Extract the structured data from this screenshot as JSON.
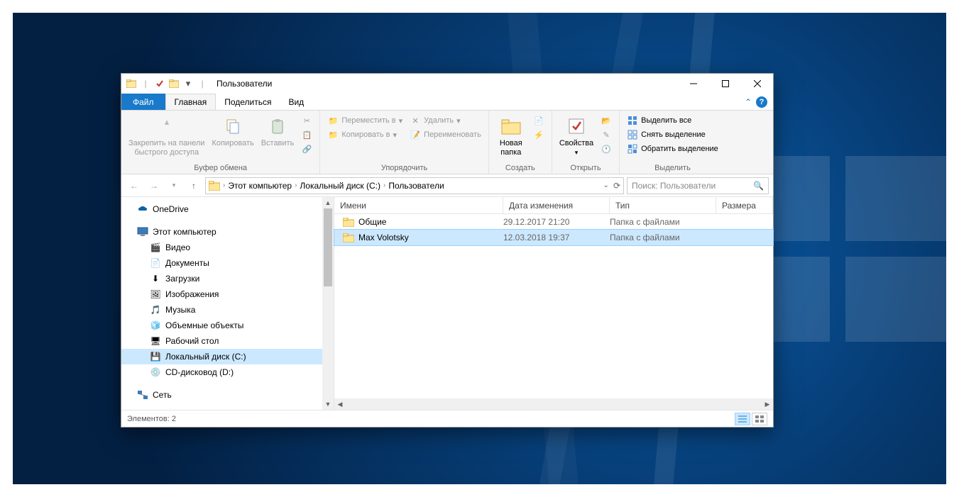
{
  "window": {
    "title": "Пользователи",
    "tabs": {
      "file": "Файл",
      "home": "Главная",
      "share": "Поделиться",
      "view": "Вид"
    }
  },
  "ribbon": {
    "clipboard": {
      "label": "Буфер обмена",
      "pin": "Закрепить на панели\nбыстрого доступа",
      "copy": "Копировать",
      "paste": "Вставить"
    },
    "organize": {
      "label": "Упорядочить",
      "move": "Переместить в",
      "copyto": "Копировать в",
      "delete": "Удалить",
      "rename": "Переименовать"
    },
    "new": {
      "label": "Создать",
      "folder": "Новая\nпапка"
    },
    "open": {
      "label": "Открыть",
      "props": "Свойства"
    },
    "select": {
      "label": "Выделить",
      "all": "Выделить все",
      "none": "Снять выделение",
      "invert": "Обратить выделение"
    }
  },
  "breadcrumbs": [
    "Этот компьютер",
    "Локальный диск (C:)",
    "Пользователи"
  ],
  "search": {
    "placeholder": "Поиск: Пользователи"
  },
  "tree": {
    "onedrive": "OneDrive",
    "thispc": "Этот компьютер",
    "items": [
      "Видео",
      "Документы",
      "Загрузки",
      "Изображения",
      "Музыка",
      "Объемные объекты",
      "Рабочий стол",
      "Локальный диск (C:)",
      "CD-дисковод (D:)"
    ],
    "network": "Сеть"
  },
  "columns": {
    "name": "Имени",
    "date": "Дата изменения",
    "type": "Тип",
    "size": "Размера"
  },
  "rows": [
    {
      "name": "Общие",
      "date": "29.12.2017 21:20",
      "type": "Папка с файлами",
      "selected": false
    },
    {
      "name": "Max Volotsky",
      "date": "12.03.2018 19:37",
      "type": "Папка с файлами",
      "selected": true
    }
  ],
  "status": "Элементов: 2"
}
